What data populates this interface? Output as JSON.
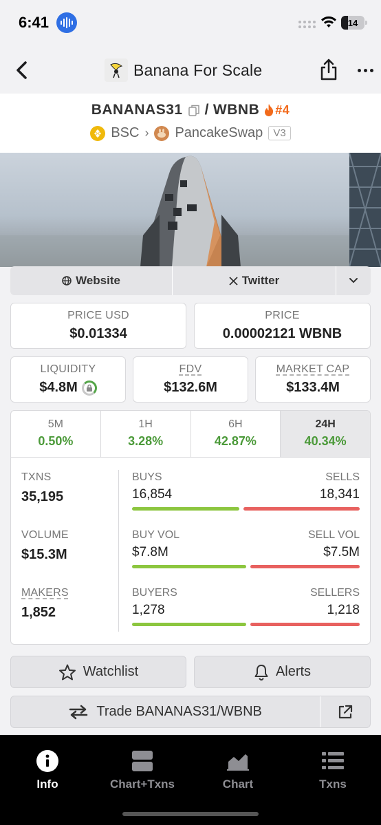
{
  "status_bar": {
    "time": "6:41",
    "battery": "14"
  },
  "nav": {
    "title": "Banana For Scale"
  },
  "pair": {
    "base": "BANANAS31",
    "separator": "/",
    "quote": "WBNB",
    "rank": "#4",
    "chain": "BSC",
    "dex": "PancakeSwap",
    "version": "V3"
  },
  "links": {
    "website": "Website",
    "twitter": "Twitter"
  },
  "price": {
    "usd_label": "PRICE USD",
    "usd_value": "$0.01334",
    "native_label": "PRICE",
    "native_value": "0.00002121 WBNB"
  },
  "metrics": {
    "liquidity_label": "LIQUIDITY",
    "liquidity_value": "$4.8M",
    "fdv_label": "FDV",
    "fdv_value": "$132.6M",
    "mcap_label": "MARKET CAP",
    "mcap_value": "$133.4M"
  },
  "timeframes": [
    {
      "label": "5M",
      "value": "0.50%"
    },
    {
      "label": "1H",
      "value": "3.28%"
    },
    {
      "label": "6H",
      "value": "42.87%"
    },
    {
      "label": "24H",
      "value": "40.34%"
    }
  ],
  "stats": {
    "txns_label": "TXNS",
    "txns_value": "35,195",
    "volume_label": "VOLUME",
    "volume_value": "$15.3M",
    "makers_label": "MAKERS",
    "makers_value": "1,852",
    "buys_label": "BUYS",
    "buys_value": "16,854",
    "sells_label": "SELLS",
    "sells_value": "18,341",
    "buy_vol_label": "BUY VOL",
    "buy_vol_value": "$7.8M",
    "sell_vol_label": "SELL VOL",
    "sell_vol_value": "$7.5M",
    "buyers_label": "BUYERS",
    "buyers_value": "1,278",
    "sellers_label": "SELLERS",
    "sellers_value": "1,218",
    "buys_share": 0.479,
    "buy_vol_share": 0.51,
    "buyers_share": 0.512
  },
  "actions": {
    "watchlist": "Watchlist",
    "alerts": "Alerts",
    "trade": "Trade BANANAS31/WBNB"
  },
  "tabs": [
    {
      "label": "Info",
      "icon": "info-icon"
    },
    {
      "label": "Chart+Txns",
      "icon": "layout-icon"
    },
    {
      "label": "Chart",
      "icon": "area-chart-icon"
    },
    {
      "label": "Txns",
      "icon": "list-icon"
    }
  ],
  "colors": {
    "positive": "#4c9a3a",
    "buy_bar": "#8cc63f",
    "sell_bar": "#e8615f",
    "rank": "#f26a1b",
    "accent_blue": "#2f6fe4"
  }
}
